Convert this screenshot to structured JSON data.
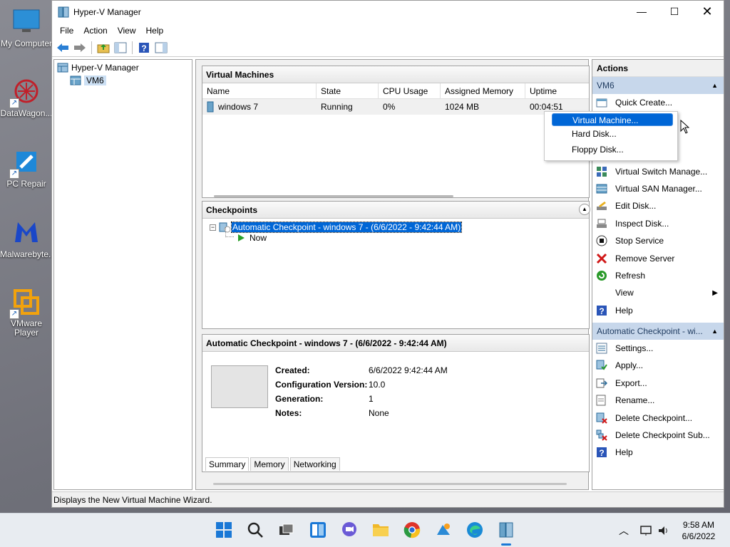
{
  "desktop": {
    "icons": [
      {
        "label": "My Computer",
        "name": "my-computer"
      },
      {
        "label": "DataWagon...",
        "name": "datawagon"
      },
      {
        "label": "PC Repair",
        "name": "pc-repair"
      },
      {
        "label": "Malwarebyte...",
        "name": "malwarebytes"
      },
      {
        "label": "VMware\nPlayer",
        "name": "vmware-player"
      }
    ]
  },
  "window": {
    "title": "Hyper-V Manager",
    "menu": [
      "File",
      "Action",
      "View",
      "Help"
    ],
    "status": "Displays the New Virtual Machine Wizard."
  },
  "tree": {
    "root": "Hyper-V Manager",
    "child": "VM6"
  },
  "vms": {
    "title": "Virtual Machines",
    "columns": [
      "Name",
      "State",
      "CPU Usage",
      "Assigned Memory",
      "Uptime"
    ],
    "rows": [
      {
        "name": "windows 7",
        "state": "Running",
        "cpu": "0%",
        "memory": "1024 MB",
        "uptime": "00:04:51"
      }
    ]
  },
  "checkpoints": {
    "title": "Checkpoints",
    "item": "Automatic Checkpoint - windows 7 - (6/6/2022 - 9:42:44 AM)",
    "now": "Now"
  },
  "details": {
    "title": "Automatic Checkpoint - windows 7 - (6/6/2022 - 9:42:44 AM)",
    "created_label": "Created:",
    "created": "6/6/2022 9:42:44 AM",
    "config_label": "Configuration Version:",
    "config": "10.0",
    "gen_label": "Generation:",
    "gen": "1",
    "notes_label": "Notes:",
    "notes": "None",
    "tabs": [
      "Summary",
      "Memory",
      "Networking"
    ]
  },
  "actions": {
    "title": "Actions",
    "group1": "VM6",
    "quick_create": "Quick Create...",
    "submenu": [
      "Virtual Machine...",
      "Hard Disk...",
      "Floppy Disk..."
    ],
    "items1": [
      "Virtual Switch Manage...",
      "Virtual SAN Manager...",
      "Edit Disk...",
      "Inspect Disk...",
      "Stop Service",
      "Remove Server",
      "Refresh",
      "View",
      "Help"
    ],
    "group2": "Automatic Checkpoint - wi...",
    "items2": [
      "Settings...",
      "Apply...",
      "Export...",
      "Rename...",
      "Delete Checkpoint...",
      "Delete Checkpoint Sub...",
      "Help"
    ]
  },
  "taskbar": {
    "time": "9:58 AM",
    "date": "6/6/2022"
  }
}
